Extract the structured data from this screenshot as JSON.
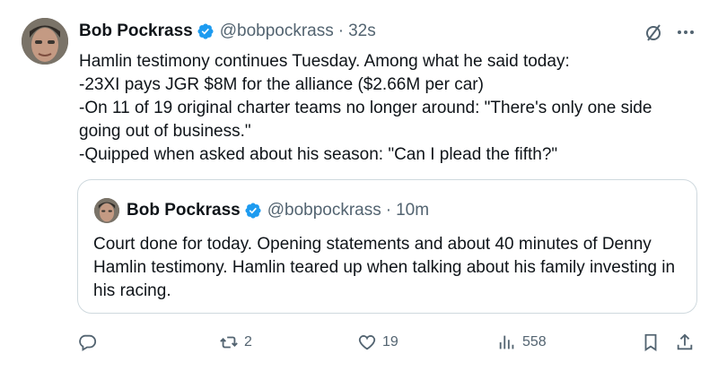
{
  "tweet": {
    "author_name": "Bob Pockrass",
    "handle": "@bobpockrass",
    "separator": "·",
    "time": "32s",
    "lines": [
      "Hamlin testimony continues Tuesday. Among what he said today:",
      "-23XI pays JGR $8M for the alliance ($2.66M per car)",
      "-On 11 of 19 original charter teams no longer around: \"There's only one side going out of business.\"",
      "-Quipped when asked about his season: \"Can I plead the fifth?\""
    ]
  },
  "quoted_tweet": {
    "author_name": "Bob Pockrass",
    "handle": "@bobpockrass",
    "separator": "·",
    "time": "10m",
    "text": "Court done for today. Opening statements and about 40 minutes of Denny Hamlin testimony. Hamlin teared up when talking about his family investing in his racing."
  },
  "actions": {
    "reply_count": "",
    "repost_count": "2",
    "like_count": "19",
    "views_count": "558"
  },
  "icons": {
    "verified": "verified-badge-icon",
    "grok": "grok-icon",
    "more": "more-icon",
    "reply": "reply-icon",
    "repost": "repost-icon",
    "like": "heart-icon",
    "views": "views-icon",
    "bookmark": "bookmark-icon",
    "share": "share-icon"
  },
  "colors": {
    "text": "#0f1419",
    "secondary": "#536471",
    "verified": "#1d9bf0",
    "border": "#cfd9de"
  }
}
